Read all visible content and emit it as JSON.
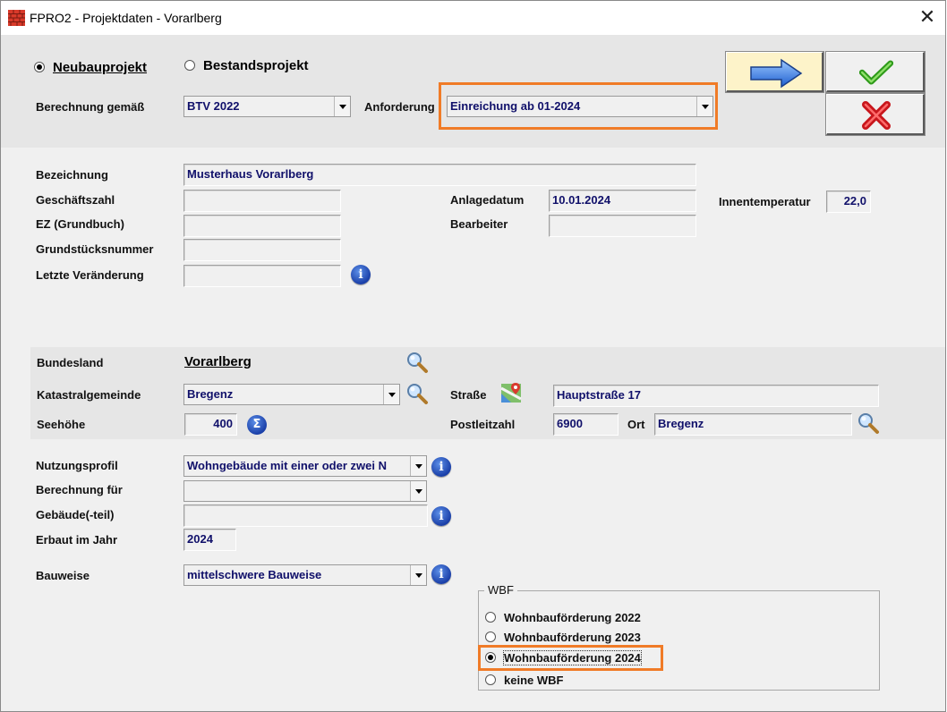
{
  "window": {
    "title": "FPRO2 - Projektdaten - Vorarlberg",
    "close_symbol": "✕",
    "app_icon": "brick-wall-icon"
  },
  "project_type": {
    "options": [
      {
        "label": "Neubauprojekt",
        "selected": true
      },
      {
        "label": "Bestandsprojekt",
        "selected": false
      }
    ]
  },
  "calc": {
    "label": "Berechnung gemäß",
    "value": "BTV 2022",
    "requirement_label": "Anforderung",
    "requirement_value": "Einreichung ab 01-2024"
  },
  "buttons": {
    "next": "arrow-right-icon",
    "ok": "checkmark-icon",
    "cancel": "red-x-icon"
  },
  "general": {
    "bezeichnung_label": "Bezeichnung",
    "bezeichnung_value": "Musterhaus Vorarlberg",
    "geschaeftszahl_label": "Geschäftszahl",
    "geschaeftszahl_value": "",
    "ez_label": "EZ (Grundbuch)",
    "ez_value": "",
    "grundstueck_label": "Grundstücksnummer",
    "grundstueck_value": "",
    "letzte_label": "Letzte Veränderung",
    "letzte_value": "",
    "anlagedatum_label": "Anlagedatum",
    "anlagedatum_value": "10.01.2024",
    "bearbeiter_label": "Bearbeiter",
    "bearbeiter_value": "",
    "innentemp_label": "Innentemperatur",
    "innentemp_value": "22,0"
  },
  "location": {
    "bundesland_label": "Bundesland",
    "bundesland_value": "Vorarlberg",
    "kg_label": "Katastralgemeinde",
    "kg_value": "Bregenz",
    "seehoehe_label": "Seehöhe",
    "seehoehe_value": "400",
    "strasse_label": "Straße",
    "strasse_value": "Hauptstraße 17",
    "plz_label": "Postleitzahl",
    "plz_value": "6900",
    "ort_label": "Ort",
    "ort_value": "Bregenz"
  },
  "building": {
    "nutzung_label": "Nutzungsprofil",
    "nutzung_value": "Wohngebäude mit einer oder zwei N",
    "berechnung_fuer_label": "Berechnung für",
    "berechnung_fuer_value": "",
    "gebaeude_label": "Gebäude(-teil)",
    "gebaeude_value": "",
    "erbaut_label": "Erbaut im Jahr",
    "erbaut_value": "2024",
    "bauweise_label": "Bauweise",
    "bauweise_value": "mittelschwere Bauweise"
  },
  "wbf": {
    "title": "WBF",
    "options": [
      {
        "label": "Wohnbauförderung 2022",
        "selected": false
      },
      {
        "label": "Wohnbauförderung 2023",
        "selected": false
      },
      {
        "label": "Wohnbauförderung 2024",
        "selected": true
      },
      {
        "label": "keine WBF",
        "selected": false
      }
    ]
  },
  "colors": {
    "highlight": "#f07b27",
    "value_text": "#10106a",
    "band": "#e6e6e6",
    "next_button": "#fdf3c9"
  }
}
